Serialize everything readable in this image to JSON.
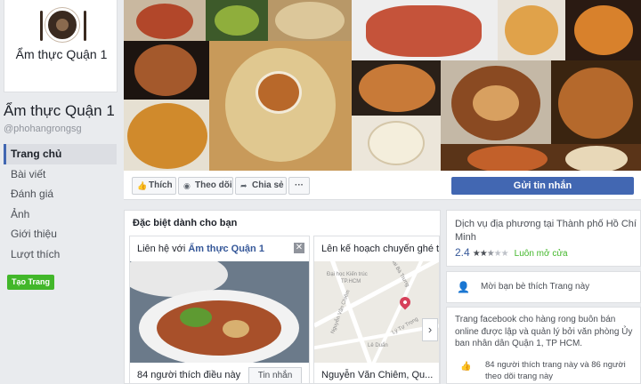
{
  "page": {
    "logo_text": "Ẩm thực Quận 1",
    "name": "Ẩm thực Quận 1",
    "handle": "@phohangrongsg"
  },
  "nav": {
    "items": [
      {
        "label": "Trang chủ",
        "active": true
      },
      {
        "label": "Bài viết"
      },
      {
        "label": "Đánh giá"
      },
      {
        "label": "Ảnh"
      },
      {
        "label": "Giới thiệu"
      },
      {
        "label": "Lượt thích"
      }
    ],
    "create_page": "Tạo Trang"
  },
  "actions": {
    "like": "Thích",
    "follow": "Theo dõi",
    "share": "Chia sẻ",
    "more": "···",
    "send_message": "Gửi tin nhắn"
  },
  "suggestions": {
    "title": "Đặc biệt dành cho bạn",
    "card1": {
      "title_prefix": "Liên hệ với ",
      "title_name": "Ẩm thực Quận 1",
      "likes": "84 người thích điều này",
      "message_button": "Tin nhắn"
    },
    "card2": {
      "title": "Lên kế hoạch chuyến ghé thă",
      "address": "Nguyễn Văn Chiêm, Qu...",
      "map_labels": [
        "Đại học Kiến trúc",
        "TP.HCM",
        "Hai Bà Trưng",
        "Nguyễn Văn Chiêm",
        "Lê Duẩn",
        "Lý Tự Trọng"
      ]
    }
  },
  "right": {
    "service": "Dịch vụ địa phương tại Thành phố Hồ Chí Minh",
    "rating": "2.4",
    "stars_full": 2,
    "stars_half": 1,
    "stars_total": 5,
    "open_status": "Luôn mở cửa",
    "invite": "Mời bạn bè thích Trang này",
    "about": "Trang facebook cho hàng rong buôn bán online được lập và quản lý bởi văn phòng Ủy ban nhân dân Quận 1, TP HCM.",
    "like_stats": "84 người thích trang này và 86 người theo dõi trang này"
  },
  "colors": {
    "primary": "#4267b2",
    "green": "#42b72a",
    "link": "#365899"
  }
}
